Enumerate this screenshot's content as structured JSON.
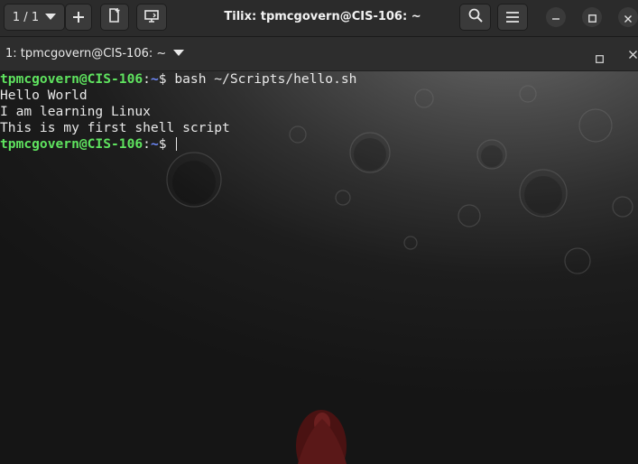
{
  "window": {
    "title": "Tilix: tpmcgovern@CIS-106: ~"
  },
  "header": {
    "session_counter": "1 / 1",
    "icons": {
      "session_dropdown": "chevron-down-icon",
      "add_session": "plus-icon",
      "open_file": "new-file-icon",
      "sync_input": "monitor-icon",
      "search": "search-icon",
      "menu": "hamburger-menu-icon",
      "minimize": "minimize-icon",
      "maximize": "maximize-icon",
      "close": "close-icon"
    }
  },
  "terminal_tab": {
    "title": "1: tpmcgovern@CIS-106: ~"
  },
  "terminal": {
    "prompt": {
      "user_host": "tpmcgovern@CIS-106",
      "separator": ":",
      "path": "~",
      "symbol": "$"
    },
    "command": "bash ~/Scripts/hello.sh",
    "output": [
      "Hello World",
      "I am learning Linux",
      "This is my first shell script"
    ]
  },
  "colors": {
    "prompt_user": "#5fe35f",
    "prompt_path": "#6f8bff",
    "text": "#e8e8e8",
    "headerbar": "#2b2b2b"
  }
}
